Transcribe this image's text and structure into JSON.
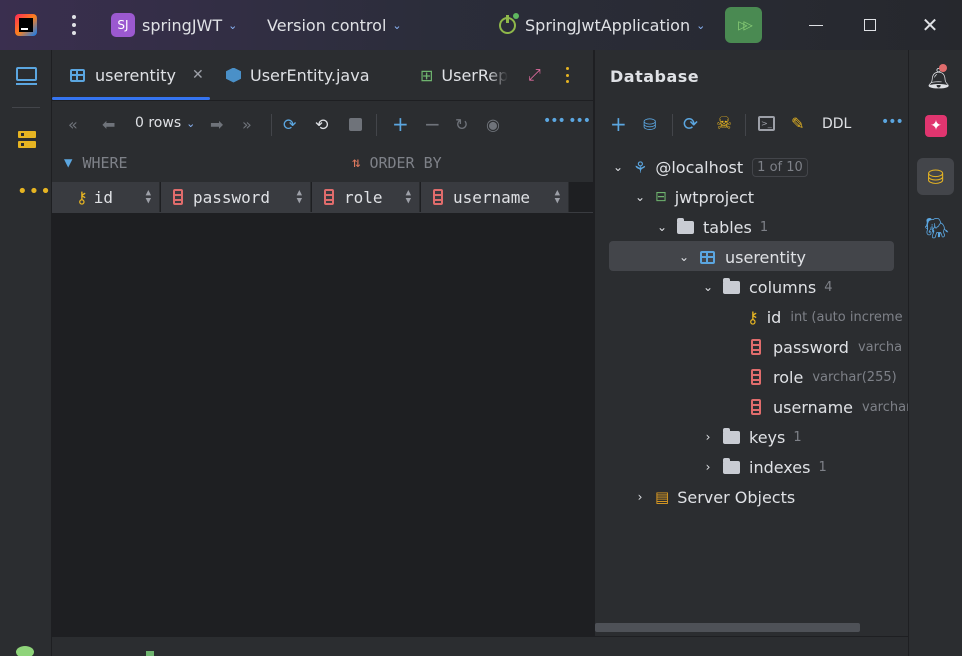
{
  "titlebar": {
    "project_badge": "SJ",
    "project_name": "springJWT",
    "vcs_label": "Version control",
    "run_config": "SpringJwtApplication"
  },
  "editor": {
    "tabs": [
      {
        "label": "userentity",
        "icon": "table-icon"
      },
      {
        "label": "UserEntity.java",
        "icon": "class-icon"
      },
      {
        "label": "UserRep",
        "icon": "repository-icon"
      }
    ],
    "toolbar": {
      "rows_label": "0 rows"
    },
    "filter": {
      "where_label": "WHERE",
      "order_label": "ORDER BY"
    },
    "columns": [
      "id",
      "password",
      "role",
      "username"
    ]
  },
  "database": {
    "title": "Database",
    "ddl_label": "DDL",
    "host": {
      "name": "@localhost",
      "badge": "1 of 10"
    },
    "schema": "jwtproject",
    "tables": {
      "label": "tables",
      "count": "1"
    },
    "table": "userentity",
    "columns": {
      "label": "columns",
      "count": "4"
    },
    "cols": [
      {
        "name": "id",
        "type": "int (auto increme"
      },
      {
        "name": "password",
        "type": "varcha"
      },
      {
        "name": "role",
        "type": "varchar(255)"
      },
      {
        "name": "username",
        "type": "varchar"
      }
    ],
    "keys": {
      "label": "keys",
      "count": "1"
    },
    "indexes": {
      "label": "indexes",
      "count": "1"
    },
    "server_objects": "Server Objects"
  },
  "colors": {
    "accent": "#3574f0",
    "run_green": "#499c54",
    "project_purple": "#9b59d0"
  }
}
